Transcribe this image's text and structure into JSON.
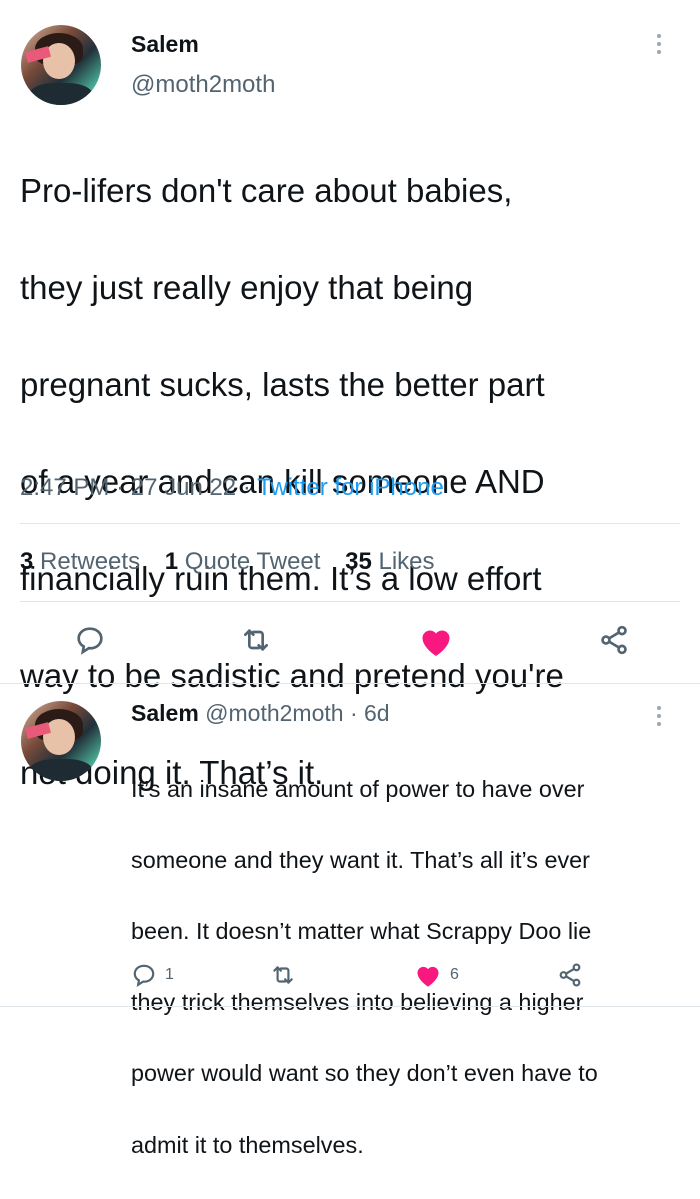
{
  "tweet": {
    "author_name": "Salem",
    "author_handle": "@moth2moth",
    "text_lines": [
      "Pro-lifers don't care about babies,",
      "they just really enjoy that being",
      "pregnant sucks, lasts the better part",
      "of a year and can kill someone AND",
      "financially ruin them. It’s a low effort",
      "way to be sadistic and pretend you're",
      "not doing it. That’s it."
    ],
    "time": "2:47 PM",
    "date": "27 Jun 22",
    "source": "Twitter for iPhone",
    "retweets_count": "3",
    "retweets_label": "Retweets",
    "quotes_count": "1",
    "quotes_label": "Quote Tweet",
    "likes_count": "35",
    "likes_label": "Likes"
  },
  "reply": {
    "author_name": "Salem",
    "author_handle": "@moth2moth",
    "age": "6d",
    "text_lines": [
      "It’s an insane amount of power to have over",
      "someone and they want it. That’s all it’s ever",
      "been. It doesn’t matter what Scrappy Doo lie",
      "they trick themselves into believing a higher",
      "power would want so they don’t even have to",
      "admit it to themselves."
    ],
    "reply_count": "1",
    "like_count": "6"
  },
  "icons": {
    "reply": "reply-icon",
    "retweet": "retweet-icon",
    "like": "heart-icon",
    "share": "share-icon",
    "more": "more-icon"
  },
  "colors": {
    "like": "#f91880",
    "link": "#1d9bf0",
    "secondary_text": "#536471"
  }
}
